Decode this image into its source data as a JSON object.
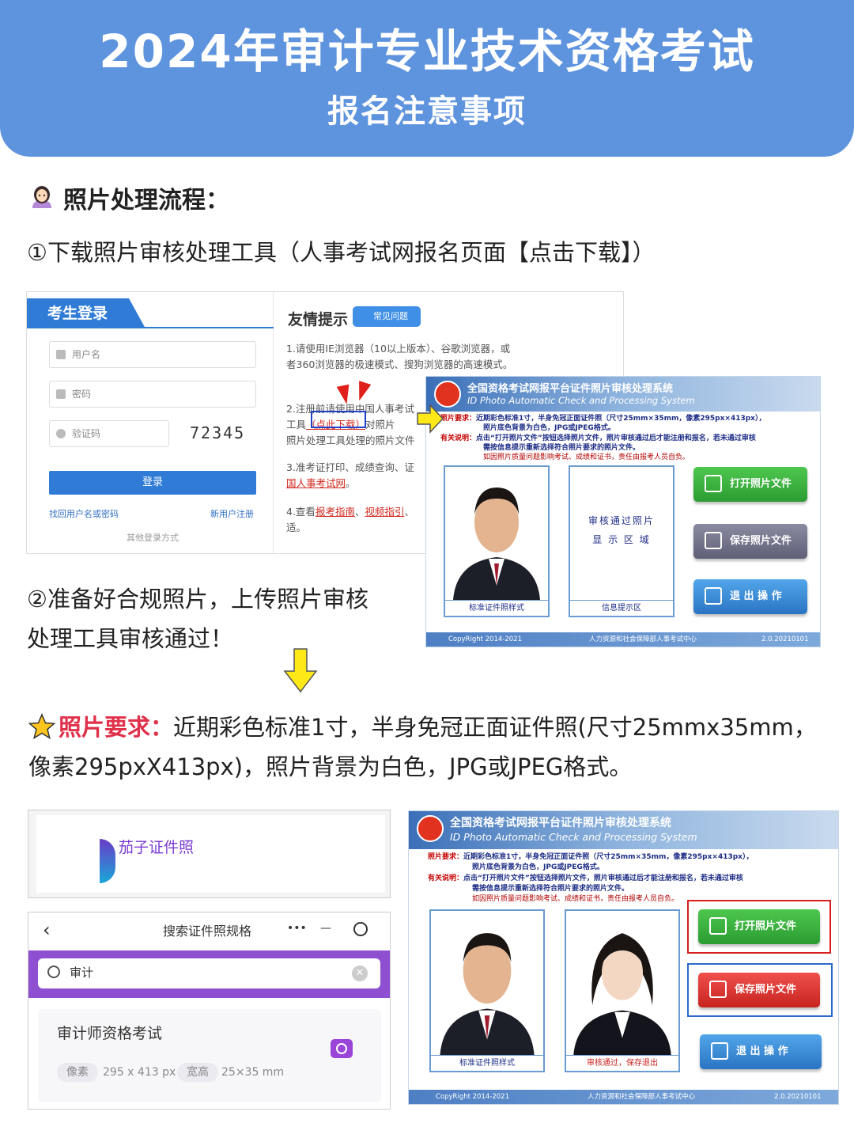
{
  "header": {
    "title": "2024年审计专业技术资格考试",
    "subtitle": "报名注意事项"
  },
  "section": {
    "title": "照片处理流程："
  },
  "steps": {
    "step1": "①下载照片审核处理工具（人事考试网报名页面【点击下载】）",
    "step2": "②准备好合规照片，上传照片审核处理工具审核通过！"
  },
  "login_panel": {
    "tab": "考生登录",
    "username_placeholder": "用户名",
    "password_placeholder": "密码",
    "captcha_placeholder": "验证码",
    "captcha_code": "72345",
    "login_button": "登录",
    "forgot_link": "找回用户名或密码",
    "register_link": "新用户注册",
    "other_login": "其他登录方式"
  },
  "tips_panel": {
    "title": "友情提示",
    "faq_badge": "常见问题",
    "tip1": "1.请使用IE浏览器（10以上版本）、谷歌浏览器，或者360浏览器的极速模式、搜狗浏览器的高速模式。",
    "tip2_a": "2.注册前请使用中国人事考试",
    "tip2_b": "工具",
    "tip2_link": "（点此下载）",
    "tip2_c": "对照片",
    "tip2_d": "照片处理工具处理的照片文件",
    "tip3_a": "3.准考证打印、成绩查询、证",
    "tip3_link": "国人事考试网",
    "tip3_b": "。",
    "tip4_a": "4.查看",
    "tip4_link1": "报考指南",
    "tip4_sep": "、",
    "tip4_link2": "视频指引",
    "tip4_b": "、",
    "tip4_c": "适。"
  },
  "photo_system": {
    "title_cn": "全国资格考试网报平台证件照片审核处理系统",
    "title_en": "ID Photo Automatic Check and Processing System",
    "req_label": "照片要求：",
    "req_text1": "近期彩色标准1寸，半身免冠正面证件照（尺寸25mm×35mm，像素295px×413px），",
    "req_text2": "照片底色背景为白色，JPG或JPEG格式。",
    "note_label": "有关说明：",
    "note_text1": "点击“打开照片文件”按钮选择照片文件，照片审核通过后才能注册和报名，若未通过审核",
    "note_text2": "需按信息提示重新选择符合照片要求的照片文件。",
    "note_text3": "如因照片质量问题影响考试、成绩和证书，责任由报考人员自负。",
    "sample_caption": "标准证件照样式",
    "zone_line1": "审核通过照片",
    "zone_line2": "显 示 区 域",
    "info_caption": "信息提示区",
    "pass_caption": "审核通过，保存退出",
    "btn_open": "打开照片文件",
    "btn_save": "保存照片文件",
    "btn_exit": "退 出 操 作",
    "footer_left": "CopyRight 2014-2021",
    "footer_mid": "人力资源和社会保障部人事考试中心",
    "footer_right": "2.0.20210101",
    "colors": {
      "green": "#2b9c32",
      "gray": "#5f6078",
      "blue": "#2a74c3",
      "red": "#c7231f"
    }
  },
  "requirement": {
    "label": "照片要求：",
    "text": "近期彩色标准1寸，半身免冠正面证件照(尺寸25mmx35mm，像素295pxX413px)，照片背景为白色，JPG或JPEG格式。"
  },
  "app": {
    "brand": "茄子证件照",
    "page_title": "搜索证件照规格",
    "capsule_more": "•••",
    "capsule_min": "—",
    "search_value": "审计",
    "result_title": "审计师资格考试",
    "tag_pixels": "像素",
    "pixels_value": "295 x 413 px",
    "tag_size": "宽高",
    "size_value": "25×35 mm"
  }
}
